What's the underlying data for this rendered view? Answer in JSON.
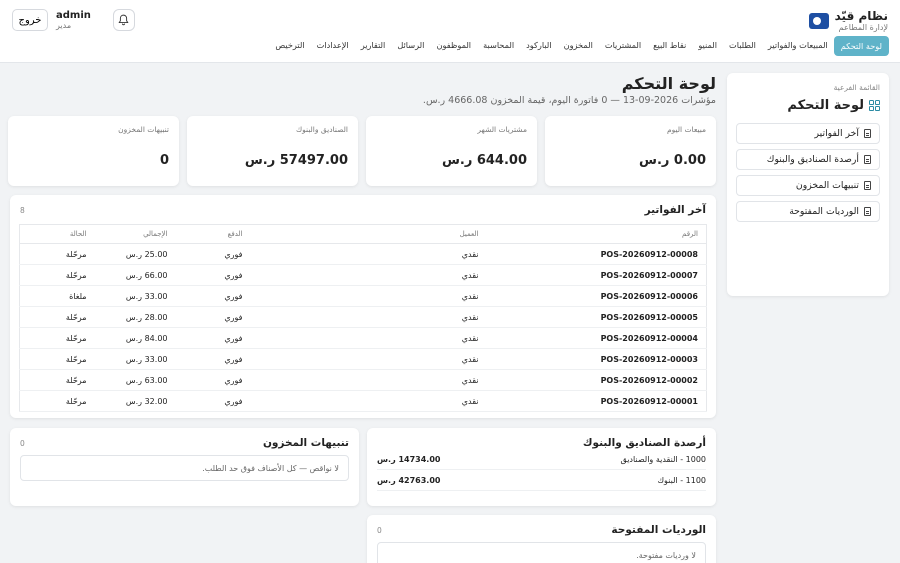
{
  "brand": {
    "title": "نظام قيّد",
    "subtitle": "لإدارة المطاعم"
  },
  "user": {
    "name": "admin",
    "role": "مدير",
    "logout_label": "خروج"
  },
  "nav": {
    "items": [
      "لوحة التحكم",
      "المبيعات والفواتير",
      "الطلبات",
      "المنيو",
      "نقاط البيع",
      "المشتريات",
      "المخزون",
      "الباركود",
      "المحاسبة",
      "الموظفون",
      "الرسائل",
      "التقارير",
      "الإعدادات",
      "الترخيص"
    ],
    "active_index": 0
  },
  "sidebar": {
    "caption": "القائمة الفرعية",
    "title": "لوحة التحكم",
    "links": [
      "آخر الفواتير",
      "أرصدة الصناديق والبنوك",
      "تنبيهات المخزون",
      "الورديات المفتوحة"
    ]
  },
  "page": {
    "title": "لوحة التحكم",
    "subtitle": "مؤشرات 2026-09-13 — 0 فاتورة اليوم، قيمة المخزون 4666.08 ر.س."
  },
  "stats": [
    {
      "label": "مبيعات اليوم",
      "value": "0.00 ر.س"
    },
    {
      "label": "مشتريات الشهر",
      "value": "644.00 ر.س"
    },
    {
      "label": "الصناديق والبنوك",
      "value": "57497.00 ر.س"
    },
    {
      "label": "تنبيهات المخزون",
      "value": "0"
    }
  ],
  "invoices": {
    "title": "آخر الفواتير",
    "count": "8",
    "columns": [
      "الرقم",
      "العميل",
      "الدفع",
      "الإجمالي",
      "الحالة"
    ],
    "rows": [
      {
        "number": "POS-20260912-00008",
        "customer": "نقدي",
        "payment": "فوري",
        "total": "25.00 ر.س",
        "status": "مرحّلة"
      },
      {
        "number": "POS-20260912-00007",
        "customer": "نقدي",
        "payment": "فوري",
        "total": "66.00 ر.س",
        "status": "مرحّلة"
      },
      {
        "number": "POS-20260912-00006",
        "customer": "نقدي",
        "payment": "فوري",
        "total": "33.00 ر.س",
        "status": "ملغاة"
      },
      {
        "number": "POS-20260912-00005",
        "customer": "نقدي",
        "payment": "فوري",
        "total": "28.00 ر.س",
        "status": "مرحّلة"
      },
      {
        "number": "POS-20260912-00004",
        "customer": "نقدي",
        "payment": "فوري",
        "total": "84.00 ر.س",
        "status": "مرحّلة"
      },
      {
        "number": "POS-20260912-00003",
        "customer": "نقدي",
        "payment": "فوري",
        "total": "33.00 ر.س",
        "status": "مرحّلة"
      },
      {
        "number": "POS-20260912-00002",
        "customer": "نقدي",
        "payment": "فوري",
        "total": "63.00 ر.س",
        "status": "مرحّلة"
      },
      {
        "number": "POS-20260912-00001",
        "customer": "نقدي",
        "payment": "فوري",
        "total": "32.00 ر.س",
        "status": "مرحّلة"
      }
    ]
  },
  "balances": {
    "title": "أرصدة الصناديق والبنوك",
    "rows": [
      {
        "account": "1000 - النقدية والصناديق",
        "amount": "14734.00 ر.س"
      },
      {
        "account": "1100 - البنوك",
        "amount": "42763.00 ر.س"
      }
    ]
  },
  "stock_alerts": {
    "title": "تنبيهات المخزون",
    "count": "0",
    "empty_text": "لا نواقص — كل الأصناف فوق حد الطلب."
  },
  "shifts": {
    "title": "الورديات المفتوحة",
    "count": "0",
    "empty_text": "لا ورديات مفتوحة."
  },
  "colors": {
    "accent": "#5fb3c9",
    "brand": "#1e4fa3"
  }
}
